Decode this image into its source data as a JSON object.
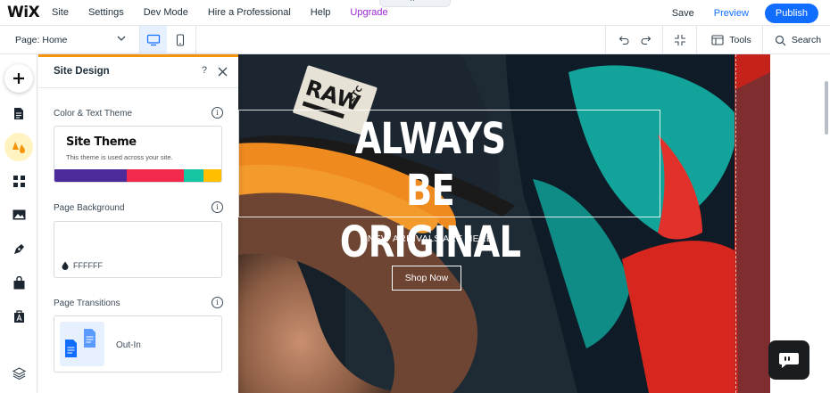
{
  "topbar": {
    "logo": "WiX",
    "menu": [
      "Site",
      "Settings",
      "Dev Mode",
      "Hire a Professional",
      "Help",
      "Upgrade"
    ],
    "collapse_glyph": "^",
    "save": "Save",
    "preview": "Preview",
    "publish": "Publish",
    "accent_color": "#116dff",
    "upgrade_color": "#9a27d5"
  },
  "toolbar": {
    "page_select": "Page: Home",
    "tools": "Tools",
    "search": "Search",
    "icons": [
      "chevron-down-icon",
      "desktop-icon",
      "mobile-icon",
      "undo-icon",
      "redo-icon",
      "zoom-out-icon",
      "tools-icon",
      "search-icon"
    ]
  },
  "rail": {
    "icons": [
      "add-icon",
      "pages-icon",
      "design-icon",
      "apps-icon",
      "media-icon",
      "blog-icon",
      "store-icon",
      "business-icon",
      "layers-icon"
    ]
  },
  "panel": {
    "title": "Site Design",
    "help": "?",
    "sections": {
      "color_theme": {
        "label": "Color & Text Theme",
        "theme_title": "Site Theme",
        "theme_subtitle": "This theme is used across your site.",
        "swatches": [
          {
            "color": "#4c2a9a",
            "weight": 80
          },
          {
            "color": "#f2294a",
            "weight": 63
          },
          {
            "color": "#14c4a3",
            "weight": 22
          },
          {
            "color": "#ffbf00",
            "weight": 22
          }
        ]
      },
      "page_background": {
        "label": "Page Background",
        "value": "FFFFFF"
      },
      "page_transitions": {
        "label": "Page Transitions",
        "value": "Out-In"
      }
    },
    "accent_color": "#f5930a"
  },
  "hero": {
    "title_line1": "ALWAYS BE",
    "title_line2": "ORIGINAL",
    "subtitle": "NEW ARRIVALS ARE HERE",
    "button": "Shop Now",
    "badge_text_1": "RAW",
    "badge_text_2": "ETC"
  }
}
